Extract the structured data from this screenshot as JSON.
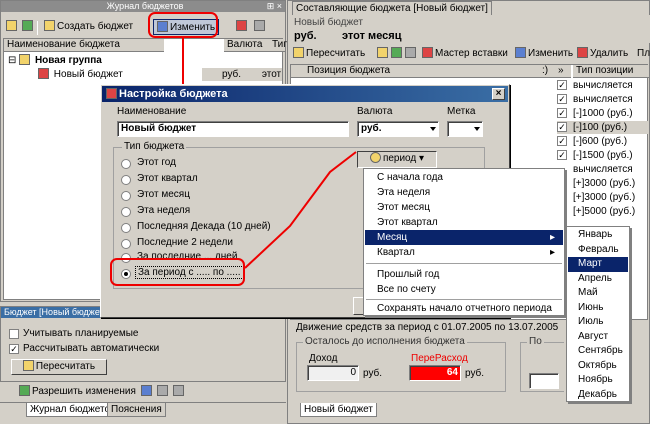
{
  "left_journal": {
    "title": "Журнал бюджетов",
    "toolbar": {
      "create": "Создать бюджет",
      "edit": "Изменить"
    },
    "columns": [
      "Наименование бюджета",
      "Валюта",
      "Тип"
    ],
    "group": "Новая группа",
    "row": {
      "name": "Новый бюджет",
      "currency": "руб.",
      "type": "этот"
    }
  },
  "budget_panel": {
    "title": "Бюджет [Новый бюджет]",
    "check_plan": "Учитывать планируемые",
    "check_auto": "Рассчитывать автоматически",
    "recalc": "Пересчитать"
  },
  "bottom_left": {
    "allow": "Разрешить изменения",
    "tabs": [
      "Журнал бюджетов",
      "Пояснения"
    ]
  },
  "right_editor": {
    "tab": "Составляющие бюджета [Новый бюджет]",
    "subtitle": "Новый бюджет",
    "currency": "руб.",
    "period": "этот месяц",
    "toolbar": {
      "recalc": "Пересчитать",
      "wizard": "Мастер вставки",
      "edit": "Изменить",
      "delete": "Удалить",
      "more": "Пла"
    },
    "position_header": "Позиция бюджета",
    "marker_header": ":)",
    "type_header": "Тип позиции",
    "type_rows": [
      "вычисляется",
      "вычисляется",
      "[-]1000 (руб.)",
      "[-]100 (руб.)",
      "[-]600 (руб.)",
      "[-]1500 (руб.)",
      "вычисляется",
      "[+]3000 (руб.)",
      "[+]3000 (руб.)",
      "[+]5000 (руб.)"
    ],
    "movement": "Движение средств за период с 01.07.2005 по 13.07.2005",
    "remaining": "Осталось до исполнения бюджета",
    "income_label": "Доход",
    "income_value": "0",
    "unit": "руб.",
    "overrun_label": "ПереРасход",
    "overrun_value": "64",
    "extra_label": "По",
    "bottom_tab": "Новый бюджет"
  },
  "dialog": {
    "title": "Настройка бюджета",
    "name_label": "Наименование",
    "name_value": "Новый бюджет",
    "currency_label": "Валюта",
    "currency_value": "руб.",
    "mark_label": "Метка",
    "mark_value": "",
    "group_label": "Тип бюджета",
    "period_button": "период",
    "radios": [
      "Этот год",
      "Этот квартал",
      "Этот месяц",
      "Эта неделя",
      "Последняя Декада (10 дней)",
      "Последние 2 недели",
      "За последние ... дней",
      "За период с ..... по ....."
    ],
    "selected_radio": "За период с ..... по ....."
  },
  "period_menu": [
    "С начала года",
    "Эта неделя",
    "Этот месяц",
    "Этот квартал",
    "Месяц",
    "Квартал",
    "Прошлый год",
    "Все по счету",
    "Сохранять начало отчетного периода"
  ],
  "month_menu": [
    "Январь",
    "Февраль",
    "Март",
    "Апрель",
    "Май",
    "Июнь",
    "Июль",
    "Август",
    "Сентябрь",
    "Октябрь",
    "Ноябрь",
    "Декабрь"
  ],
  "colors": {
    "highlight": "#0a246a",
    "annotation": "#ee0000",
    "overrun": "#ff0000"
  }
}
